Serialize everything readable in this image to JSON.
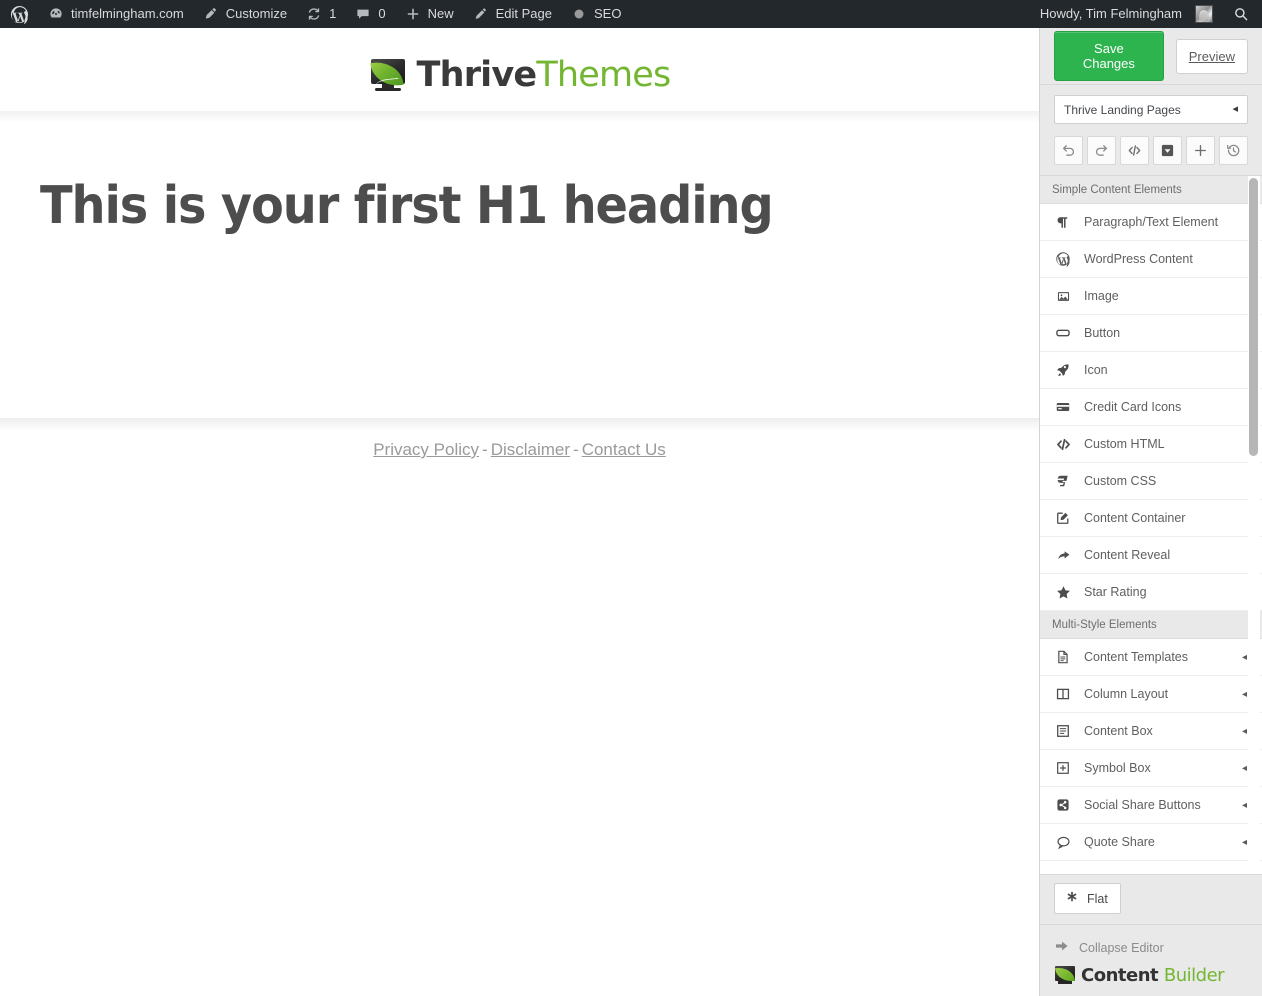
{
  "adminbar": {
    "wp_logo_icon": "wordpress-logo-icon",
    "left_items": [
      {
        "icon": "dashboard-icon",
        "label": "timfelmingham.com"
      },
      {
        "icon": "brush-icon",
        "label": "Customize"
      },
      {
        "icon": "refresh-icon",
        "label": "1"
      },
      {
        "icon": "comment-icon",
        "label": "0"
      },
      {
        "icon": "plus-icon",
        "label": "New"
      },
      {
        "icon": "pencil-icon",
        "label": "Edit Page"
      },
      {
        "icon": "circle-icon",
        "label": "SEO"
      }
    ],
    "howdy": "Howdy, Tim Felmingham",
    "avatar_name": "avatar",
    "search_icon": "search-icon"
  },
  "site": {
    "logo": {
      "word_dark": "Thrive",
      "word_green": "Themes",
      "icon": "thrive-themes-logo-icon"
    },
    "heading": "This is your first H1 heading",
    "footer_links": [
      {
        "label": "Privacy Policy"
      },
      {
        "label": "Disclaimer"
      },
      {
        "label": "Contact Us"
      }
    ],
    "footer_separator": "-"
  },
  "sidebar": {
    "save_label": "Save Changes",
    "preview_label": "Preview",
    "template_select": {
      "value": "Thrive Landing Pages",
      "caret": "◂"
    },
    "toolbar": [
      {
        "name": "undo-icon",
        "title": "Undo"
      },
      {
        "name": "redo-icon",
        "title": "Redo"
      },
      {
        "name": "code-icon",
        "title": "Code"
      },
      {
        "name": "save-box-icon",
        "title": "Save"
      },
      {
        "name": "plus-icon",
        "title": "Add"
      },
      {
        "name": "history-icon",
        "title": "Revisions"
      }
    ],
    "groups": [
      {
        "title": "Simple Content Elements",
        "items": [
          {
            "label": "Paragraph/Text Element",
            "icon": "pilcrow-icon",
            "arrow": false
          },
          {
            "label": "WordPress Content",
            "icon": "wordpress-icon",
            "arrow": false
          },
          {
            "label": "Image",
            "icon": "image-icon",
            "arrow": false
          },
          {
            "label": "Button",
            "icon": "button-icon",
            "arrow": false
          },
          {
            "label": "Icon",
            "icon": "rocket-icon",
            "arrow": false
          },
          {
            "label": "Credit Card Icons",
            "icon": "credit-card-icon",
            "arrow": false
          },
          {
            "label": "Custom HTML",
            "icon": "code-icon",
            "arrow": false
          },
          {
            "label": "Custom CSS",
            "icon": "css3-icon",
            "arrow": false
          },
          {
            "label": "Content Container",
            "icon": "edit-square-icon",
            "arrow": false
          },
          {
            "label": "Content Reveal",
            "icon": "share-arrow-icon",
            "arrow": false
          },
          {
            "label": "Star Rating",
            "icon": "star-icon",
            "arrow": false
          }
        ]
      },
      {
        "title": "Multi-Style Elements",
        "items": [
          {
            "label": "Content Templates",
            "icon": "document-icon",
            "arrow": true
          },
          {
            "label": "Column Layout",
            "icon": "columns-icon",
            "arrow": true
          },
          {
            "label": "Content Box",
            "icon": "content-box-icon",
            "arrow": true
          },
          {
            "label": "Symbol Box",
            "icon": "plus-box-icon",
            "arrow": true
          },
          {
            "label": "Social Share Buttons",
            "icon": "share-nodes-icon",
            "arrow": true
          },
          {
            "label": "Quote Share",
            "icon": "speech-bubble-icon",
            "arrow": true
          }
        ]
      }
    ],
    "arrow_glyph": "◂",
    "skin": {
      "label": "Flat",
      "icon": "asterisk-icon"
    },
    "collapse": {
      "label": "Collapse Editor",
      "icon": "arrow-right-icon"
    },
    "content_builder": {
      "word_dark": "Content",
      "word_green": "Builder",
      "icon": "content-builder-logo-icon"
    }
  },
  "colors": {
    "admin_bar": "#23282d",
    "accent_green": "#2eb44e",
    "brand_green": "#73b632",
    "sidebar_bg": "#e9e9e9",
    "heading": "#4d4d4d"
  }
}
